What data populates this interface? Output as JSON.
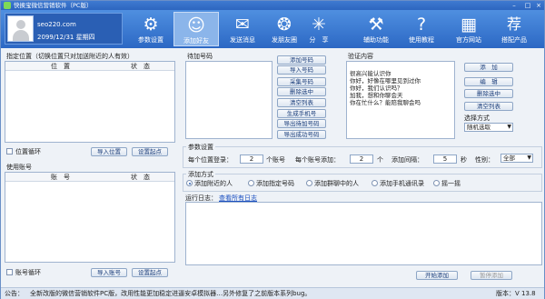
{
  "window": {
    "title": "快换宝微信营销软件（PC版）"
  },
  "profile": {
    "name": "seo220.com",
    "date": "2099/12/31 星期四"
  },
  "toolbar": [
    {
      "label": "参数设置",
      "icon": "gear-icon",
      "glyph": "⚙"
    },
    {
      "label": "添加好友",
      "icon": "add-user-icon",
      "glyph": "👤"
    },
    {
      "label": "发送消息",
      "icon": "send-message-icon",
      "glyph": "✉"
    },
    {
      "label": "发朋友圈",
      "icon": "moments-icon",
      "glyph": "❂"
    },
    {
      "label": "分　享",
      "icon": "share-icon",
      "glyph": "✳"
    },
    {
      "label": "辅助功能",
      "icon": "tools-icon",
      "glyph": "⚒"
    },
    {
      "label": "使用教程",
      "icon": "help-icon",
      "glyph": "?"
    },
    {
      "label": "官方网站",
      "icon": "website-icon",
      "glyph": "▦"
    },
    {
      "label": "搭配产品",
      "icon": "recommend-icon",
      "glyph": "荐"
    }
  ],
  "location": {
    "title": "指定位置（切换位置只对加送附近的人有效）",
    "col_position": "位　置",
    "col_status": "状　态",
    "loop_label": "位置循环",
    "import_button": "导入位置",
    "settings_button": "设置起点"
  },
  "account": {
    "title": "使用账号",
    "col_account": "账　号",
    "col_status": "状　态",
    "loop_label": "账号循环",
    "import_button": "导入账号",
    "settings_button": "设置起点"
  },
  "numbers": {
    "title": "待加号码",
    "buttons": [
      "添加号码",
      "导入号码",
      "采集号码",
      "删除选中",
      "清空列表",
      "生成手机号",
      "导出待加号码",
      "导出成功号码"
    ]
  },
  "verify": {
    "title": "验证内容",
    "text": "很高兴能认识你\n你好，好像在哪里见到过你\n你好，我们认识吗？\n加我，想和你聊会天\n你在忙什么？能陪我聊会吗",
    "buttons": [
      "添　加",
      "编　辑",
      "删除选中",
      "清空列表"
    ],
    "mode_label": "选择方式",
    "mode_value": "随机选取"
  },
  "params": {
    "title": "参数设置",
    "per_login_label": "每个位置登录：",
    "per_login_value": "2",
    "unit1": "个账号",
    "per_account_label": "每个账号添加：",
    "per_account_value": "2",
    "unit2": "个",
    "interval_label": "添加间隔：",
    "interval_value": "5",
    "unit3": "秒",
    "gender_label": "性别：",
    "gender_value": "全部"
  },
  "add_mode": {
    "title": "添加方式",
    "options": [
      "添加附近的人",
      "添加指定号码",
      "添加群聊中的人",
      "添加手机通讯录",
      "摇一摇"
    ],
    "selected_index": 0
  },
  "log": {
    "title": "运行日志：",
    "link": "查看所有日志"
  },
  "actions": {
    "start": "开始添加",
    "pause": "暂停添加"
  },
  "status": {
    "notice_label": "公告：",
    "notice": "全新改版的微信营销软件PC版，改用性能更加稳定进逼安卓模拟器…另外修复了之前版本系列bug。",
    "version": "版本：V 13.8"
  },
  "colors": {
    "toolbar": "#2c68c4",
    "accent": "#1a4fc0"
  }
}
